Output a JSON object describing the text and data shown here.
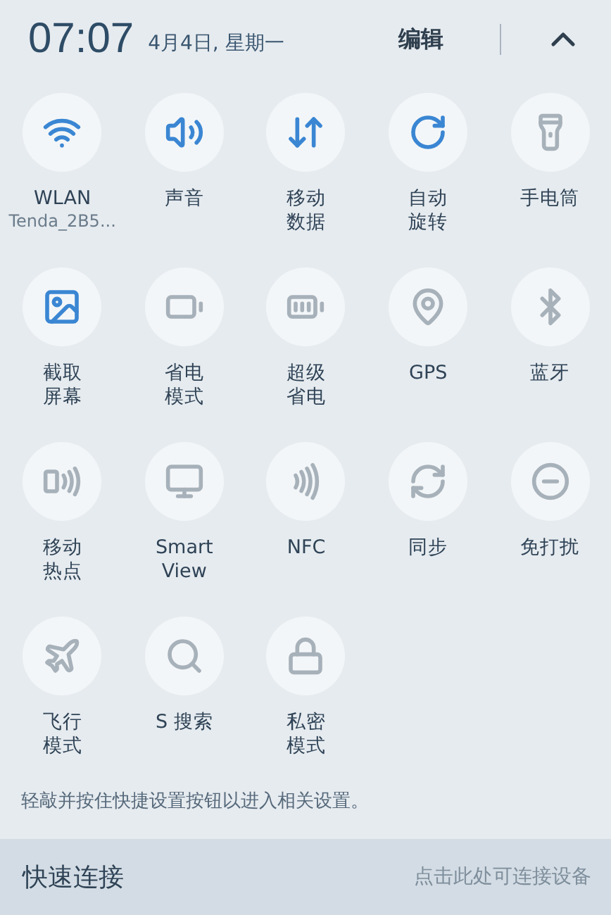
{
  "header": {
    "time": "07:07",
    "date": "4月4日, 星期一",
    "edit": "编辑"
  },
  "tiles": [
    {
      "label": [
        "WLAN"
      ],
      "sub": "Tenda_2B5...",
      "on": true
    },
    {
      "label": [
        "声音"
      ],
      "on": true
    },
    {
      "label": [
        "移动",
        "数据"
      ],
      "on": true
    },
    {
      "label": [
        "自动",
        "旋转"
      ],
      "on": true
    },
    {
      "label": [
        "手电筒"
      ],
      "on": false
    },
    {
      "label": [
        "截取",
        "屏幕"
      ],
      "on": true
    },
    {
      "label": [
        "省电",
        "模式"
      ],
      "on": false
    },
    {
      "label": [
        "超级",
        "省电"
      ],
      "on": false
    },
    {
      "label": [
        "GPS"
      ],
      "on": false
    },
    {
      "label": [
        "蓝牙"
      ],
      "on": false
    },
    {
      "label": [
        "移动",
        "热点"
      ],
      "on": false
    },
    {
      "label": [
        "Smart",
        "View"
      ],
      "on": false
    },
    {
      "label": [
        "NFC"
      ],
      "on": false
    },
    {
      "label": [
        "同步"
      ],
      "on": false
    },
    {
      "label": [
        "免打扰"
      ],
      "on": false
    },
    {
      "label": [
        "飞行",
        "模式"
      ],
      "on": false
    },
    {
      "label": [
        "S 搜索"
      ],
      "on": false
    },
    {
      "label": [
        "私密",
        "模式"
      ],
      "on": false
    }
  ],
  "hint": "轻敲并按住快捷设置按钮以进入相关设置。",
  "quick_connect": {
    "title": "快速连接",
    "action": "点击此处可连接设备"
  }
}
